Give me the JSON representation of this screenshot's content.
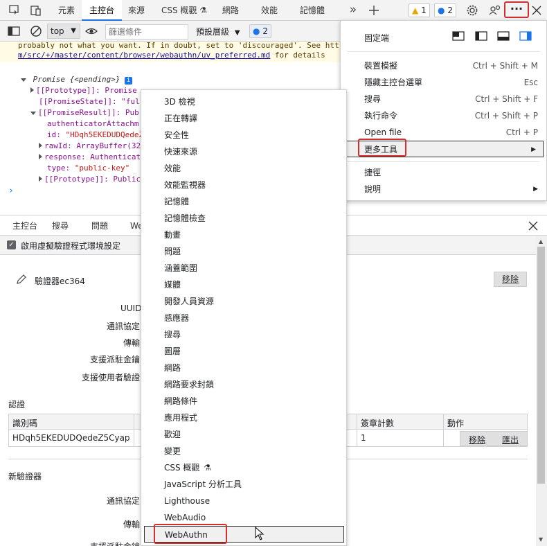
{
  "tabbar": {
    "tabs": [
      "元素",
      "主控台",
      "來源",
      "CSS 概觀",
      "網路",
      "效能",
      "記憶體"
    ],
    "warnings_count": "1",
    "messages_count": "2"
  },
  "console_toolbar": {
    "context": "top",
    "filter_placeholder": "篩選條件",
    "levels": "預設層級",
    "issues_count": "2"
  },
  "console": {
    "warn_line1": "probably not what you want. If in doubt, set to 'discouraged'. See htt",
    "warn_link": "m/src/+/master/content/browser/webauthn/uv_preferred.md",
    "warn_rest": " for details",
    "promise": "Promise {<pending>}",
    "prototype": "[[Prototype]]: Promise",
    "promise_state": "[[PromiseState]]: \"ful",
    "promise_result": "[[PromiseResult]]: Pub",
    "authenticator_attachment": "authenticatorAttachm",
    "id_key": "id: ",
    "id_val": "\"HDqh5EKEDUDQedeZ",
    "rawid": "rawId: ArrayBuffer(32",
    "response": "response: Authenticat",
    "type_key": "type: ",
    "type_val": "\"public-key\"",
    "proto2": "[[Prototype]]: Public"
  },
  "drawer": {
    "tabs": [
      "主控台",
      "搜尋",
      "問題",
      "We"
    ],
    "enable_label": "啟用虛擬驗證程式環境設定",
    "authenticator_title": "驗證器ec364",
    "remove_label": "移除",
    "props": [
      "UUID",
      "通訊協定",
      "傳輸",
      "支援派駐金鑰",
      "支援使用者驗證"
    ],
    "credentials_heading": "認證",
    "table_headers": [
      "識別碼",
      "簽章計數",
      "動作"
    ],
    "row_id": "HDqh5EKEDUDQedeZ5Cyapw...",
    "row_count": "1",
    "row_remove": "移除",
    "row_export": "匯出",
    "new_heading": "新驗證器",
    "new_props": [
      "通訊協定",
      "傳輸",
      "支援派駐金鑰"
    ]
  },
  "main_menu": {
    "dock_label": "固定端",
    "items": [
      {
        "label": "裝置模擬",
        "shortcut": "Ctrl + Shift + M"
      },
      {
        "label": "隱藏主控台選單",
        "shortcut": "Esc"
      },
      {
        "label": "搜尋",
        "shortcut": "Ctrl + Shift + F"
      },
      {
        "label": "執行命令",
        "shortcut": "Ctrl + Shift + P"
      },
      {
        "label": "Open file",
        "shortcut": "Ctrl + P"
      },
      {
        "label": "更多工具",
        "shortcut": ""
      },
      {
        "label": "捷徑",
        "shortcut": ""
      },
      {
        "label": "說明",
        "shortcut": ""
      }
    ]
  },
  "more_tools": [
    "3D 檢視",
    "正在轉譯",
    "安全性",
    "快速來源",
    "效能",
    "效能監視器",
    "記憶體",
    "記憶體檢查",
    "動畫",
    "問題",
    "涵蓋範圍",
    "媒體",
    "開發人員資源",
    "感應器",
    "搜尋",
    "圖層",
    "網路",
    "網路要求封鎖",
    "網路條件",
    "應用程式",
    "歡迎",
    "變更",
    "CSS 概觀",
    "JavaScript 分析工具",
    "Lighthouse",
    "WebAudio",
    "WebAuthn"
  ],
  "colors": {
    "accent": "#1a73e8",
    "highlight_border": "#d32f2f"
  }
}
